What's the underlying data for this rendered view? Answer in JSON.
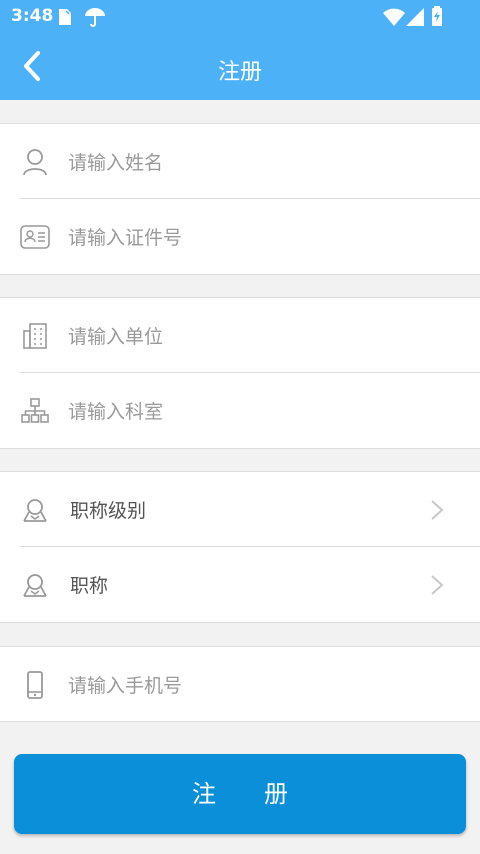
{
  "status_bar": {
    "time": "3:48"
  },
  "toolbar": {
    "title": "注册"
  },
  "form": {
    "name_placeholder": "请输入姓名",
    "id_placeholder": "请输入证件号",
    "unit_placeholder": "请输入单位",
    "dept_placeholder": "请输入科室",
    "title_level_label": "职称级别",
    "title_label": "职称",
    "phone_placeholder": "请输入手机号"
  },
  "register_button": {
    "label": "注　　册"
  },
  "colors": {
    "primary": "#4db1f7",
    "button": "#0a8fd8"
  }
}
